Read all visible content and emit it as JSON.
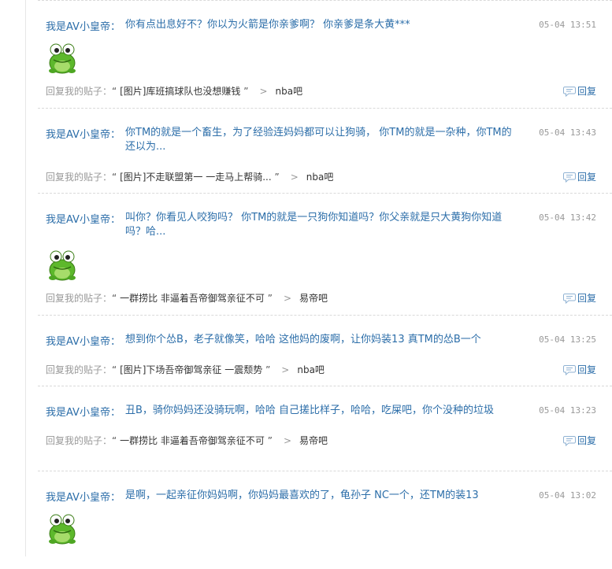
{
  "items": [
    {
      "author": "我是AV小皇帝：",
      "content": "你有点出息好不？你以为火箭是你亲爹啊？  你亲爹是条大黄***",
      "time": "05-04 13:51",
      "emoticon": "frog-emoticon",
      "reply_prefix": "回复我的贴子：",
      "open_quote": "“",
      "post_title": "[图片]库班搞球队也没想赚钱",
      "close_quote": "”",
      "sep": ">",
      "forum": "nba吧",
      "reply_label": "回复"
    },
    {
      "author": "我是AV小皇帝：",
      "content": "你TM的就是一个畜生，为了经验连妈妈都可以让狗骑，  你TM的就是一杂种，你TM的还以为...",
      "time": "05-04 13:43",
      "emoticon": "",
      "reply_prefix": "回复我的贴子：",
      "open_quote": "“",
      "post_title": "[图片]不走联盟第一 一走马上帮骑...",
      "close_quote": "”",
      "sep": ">",
      "forum": "nba吧",
      "reply_label": "回复"
    },
    {
      "author": "我是AV小皇帝：",
      "content": "叫你？你看见人咬狗吗？  你TM的就是一只狗你知道吗？你父亲就是只大黄狗你知道吗？哈...",
      "time": "05-04 13:42",
      "emoticon": "frog-emoticon",
      "reply_prefix": "回复我的贴子：",
      "open_quote": "“",
      "post_title": "一群捞比 非逼着吾帝御驾亲征不可",
      "close_quote": "”",
      "sep": ">",
      "forum": "易帝吧",
      "reply_label": "回复"
    },
    {
      "author": "我是AV小皇帝：",
      "content": "想到你个怂B，老子就像笑，哈哈 这他妈的废啊，让你妈装13 真TM的怂B一个",
      "time": "05-04 13:25",
      "emoticon": "",
      "reply_prefix": "回复我的贴子：",
      "open_quote": "“",
      "post_title": "[图片]下场吾帝御驾亲征 一震颓势",
      "close_quote": "”",
      "sep": ">",
      "forum": "nba吧",
      "reply_label": "回复"
    },
    {
      "author": "我是AV小皇帝：",
      "content": "丑B，骑你妈妈还没骑玩啊，哈哈 自己搓比样子，哈哈，吃屎吧，你个没种的垃圾",
      "time": "05-04 13:23",
      "emoticon": "",
      "reply_prefix": "回复我的贴子：",
      "open_quote": "“",
      "post_title": "一群捞比 非逼着吾帝御驾亲征不可",
      "close_quote": "”",
      "sep": ">",
      "forum": "易帝吧",
      "reply_label": "回复"
    },
    {
      "author": "我是AV小皇帝：",
      "content": "是啊，一起亲征你妈妈啊，你妈妈最喜欢的了，龟孙子 NC一个，还TM的装13",
      "time": "05-04 13:02",
      "emoticon": "frog-emoticon",
      "reply_prefix": "",
      "open_quote": "",
      "post_title": "",
      "close_quote": "",
      "sep": "",
      "forum": "",
      "reply_label": ""
    }
  ]
}
